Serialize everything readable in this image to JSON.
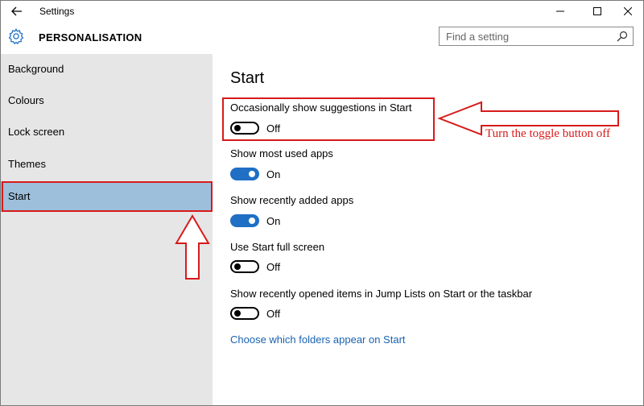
{
  "window": {
    "title": "Settings",
    "back_icon": "back-arrow-icon",
    "minimize_glyph": "—",
    "maximize_glyph": "☐",
    "close_glyph": "✕"
  },
  "header": {
    "title": "PERSONALISATION",
    "icon": "gear-icon",
    "search_placeholder": "Find a setting"
  },
  "sidebar": {
    "items": [
      {
        "label": "Background"
      },
      {
        "label": "Colours"
      },
      {
        "label": "Lock screen"
      },
      {
        "label": "Themes"
      },
      {
        "label": "Start",
        "selected": true
      }
    ]
  },
  "content": {
    "title": "Start",
    "settings": [
      {
        "label": "Occasionally show suggestions in Start",
        "state": "Off",
        "on": false
      },
      {
        "label": "Show most used apps",
        "state": "On",
        "on": true
      },
      {
        "label": "Show recently added apps",
        "state": "On",
        "on": true
      },
      {
        "label": "Use Start full screen",
        "state": "Off",
        "on": false
      },
      {
        "label": "Show recently opened items in Jump Lists on Start or the taskbar",
        "state": "Off",
        "on": false
      }
    ],
    "link": "Choose which folders appear on Start"
  },
  "annotation": {
    "text": "Turn the toggle button off",
    "color": "#d71a1a"
  },
  "colors": {
    "accent": "#1f6fc5",
    "selected_nav": "#9dbfdc",
    "sidebar_bg": "#e6e6e6",
    "link": "#1a62b0"
  }
}
